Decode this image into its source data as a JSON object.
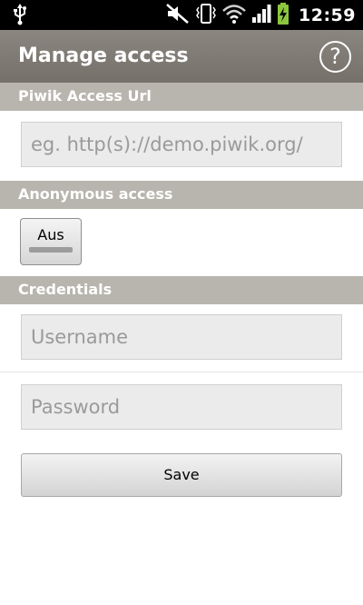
{
  "status_bar": {
    "time": "12:59",
    "icons": [
      "usb-icon",
      "mute-icon",
      "vibrate-icon",
      "wifi-icon",
      "signal-icon",
      "battery-charging-icon"
    ]
  },
  "action_bar": {
    "title": "Manage access",
    "help_glyph": "?"
  },
  "sections": {
    "access_url": {
      "header": "Piwik Access Url",
      "url_placeholder": "eg. http(s)://demo.piwik.org/"
    },
    "anonymous": {
      "header": "Anonymous access",
      "toggle_label": "Aus"
    },
    "credentials": {
      "header": "Credentials",
      "username_placeholder": "Username",
      "password_placeholder": "Password",
      "save_label": "Save"
    }
  },
  "colors": {
    "action_bar": "#7d7973",
    "section_header": "#b8b5ae",
    "battery": "#8cc63f"
  }
}
